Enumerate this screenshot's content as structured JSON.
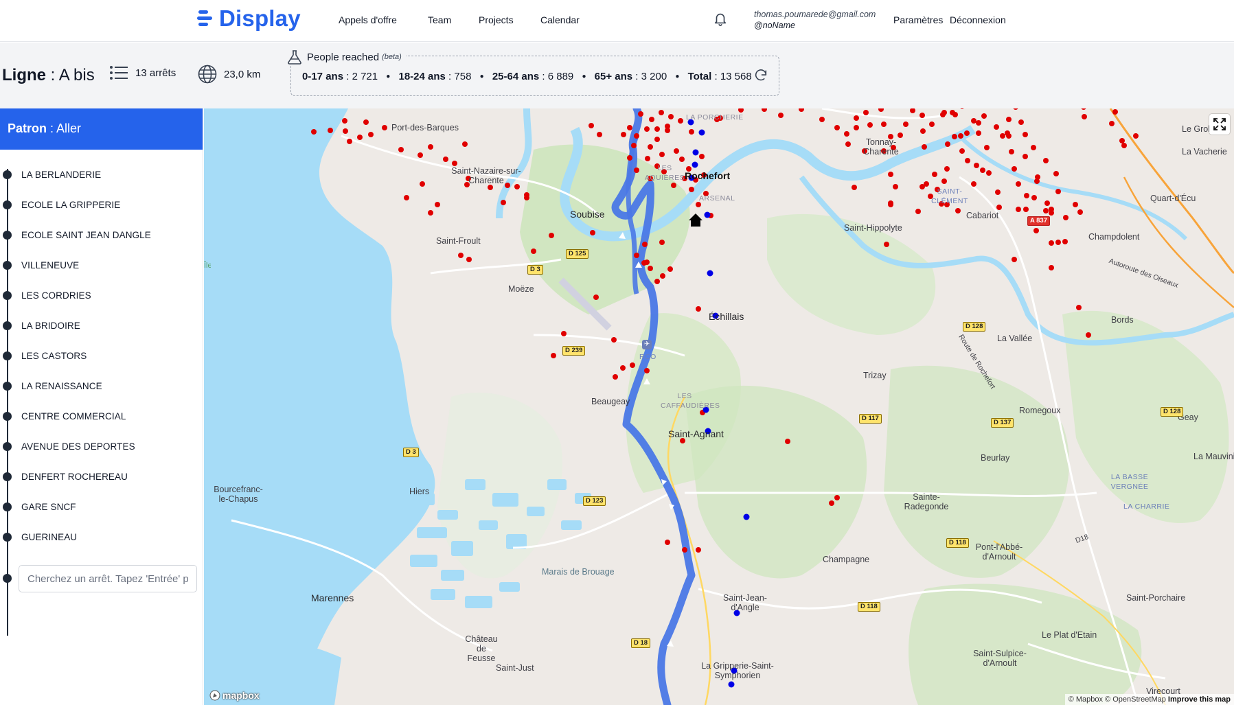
{
  "app": {
    "name": "Display",
    "accent": "#2563eb"
  },
  "nav": {
    "links": [
      "Appels d'offre",
      "Team",
      "Projects",
      "Calendar"
    ],
    "user_email": "thomas.poumarede@gmail.com",
    "user_nick": "@noName",
    "settings": "Paramètres",
    "logout": "Déconnexion"
  },
  "line": {
    "label": "Ligne",
    "name": "A bis",
    "stops_count": "13 arrêts",
    "distance": "23,0 km"
  },
  "reach": {
    "title": "People reached",
    "beta": "(beta)",
    "groups": [
      {
        "label": "0-17 ans",
        "value": "2 721"
      },
      {
        "label": "18-24 ans",
        "value": "758"
      },
      {
        "label": "25-64 ans",
        "value": "6 889"
      },
      {
        "label": "65+ ans",
        "value": "3 200"
      },
      {
        "label": "Total",
        "value": "13 568"
      }
    ]
  },
  "pattern": {
    "label": "Patron",
    "value": "Aller"
  },
  "stops": [
    "LA BERLANDERIE",
    "ECOLE LA GRIPPERIE",
    "ECOLE SAINT JEAN DANGLE",
    "VILLENEUVE",
    "LES CORDRIES",
    "LA BRIDOIRE",
    "LES CASTORS",
    "LA RENAISSANCE",
    "CENTRE COMMERCIAL",
    "AVENUE DES DEPORTES",
    "DENFERT ROCHEREAU",
    "GARE SNCF",
    "GUERINEAU"
  ],
  "stop_search": {
    "placeholder": "Cherchez un arrêt. Tapez 'Entrée' p"
  },
  "map": {
    "places": {
      "rochefort": "Rochefort",
      "port_des_barques": "Port-des-Barques",
      "saint_nazaire": "Saint-Nazaire-sur-Charente",
      "soubise": "Soubise",
      "saint_froult": "Saint-Froult",
      "moeze": "Moëze",
      "echillais": "Échillais",
      "rco": "RCO",
      "beaugeay": "Beaugeay",
      "saint_agnant": "Saint-Agnant",
      "hiers": "Hiers",
      "bourcefranc": "Bourcefranc-le-Chapus",
      "marennes": "Marennes",
      "marais": "Marais de Brouage",
      "chateau": "Château de Feusse",
      "saint_just": "Saint-Just",
      "la_gripperie": "La Gripperie-Saint-Symphorien",
      "saint_jean": "Saint-Jean-d'Angle",
      "champagne": "Champagne",
      "tonnay": "Tonnay-Charente",
      "saint_hippolyte": "Saint-Hippolyte",
      "cabariot": "Cabariot",
      "champdolent": "Champdolent",
      "quart": "Quart-d'Écu",
      "la_vacherie": "La Vacherie",
      "la_grolle": "Le Grol",
      "bords": "Bords",
      "la_vallee": "La Vallée",
      "trizay": "Trizay",
      "romegoux": "Romegoux",
      "geay": "Geay",
      "beurlay": "Beurlay",
      "la_mauvini": "La Mauvini",
      "sainte_radegonde": "Sainte-Radegonde",
      "pont_labbe": "Pont-l'Abbé-d'Arnoult",
      "saint_porchaire": "Saint-Porchaire",
      "le_plat": "Le Plat d'Etain",
      "saint_sulpice": "Saint-Sulpice-d'Arnoult",
      "virecourt": "Virecourt",
      "la_basse": "LA BASSE VERGNÉE",
      "la_charrie": "LA CHARRIE",
      "les_caffaudieres": "LES CAFFAUDIÈRES",
      "arsenal": "ARSENAL",
      "saint_clement": "SAINT-CLÉMENT",
      "les_acquiees": "LES AQUIÈRES",
      "la_porcherie": "LA PORCHERIE",
      "autoroute": "Autoroute des Oiseaux",
      "route_rochefort": "Route de Rochefort",
      "d18": "D18",
      "ile": "Île d'Aix"
    },
    "roads": [
      "D 125",
      "D 3",
      "D 239",
      "D 3",
      "D 123",
      "D 18",
      "D 117",
      "D 137",
      "D 128",
      "D 128",
      "D 118",
      "D 118",
      "A 837"
    ],
    "attribution": "© Mapbox © OpenStreetMap",
    "improve": "Improve this map",
    "mapbox": "mapbox",
    "route_color": "#4a78e6",
    "poi_color": "#e00000",
    "stop_color": "#0000e6"
  }
}
